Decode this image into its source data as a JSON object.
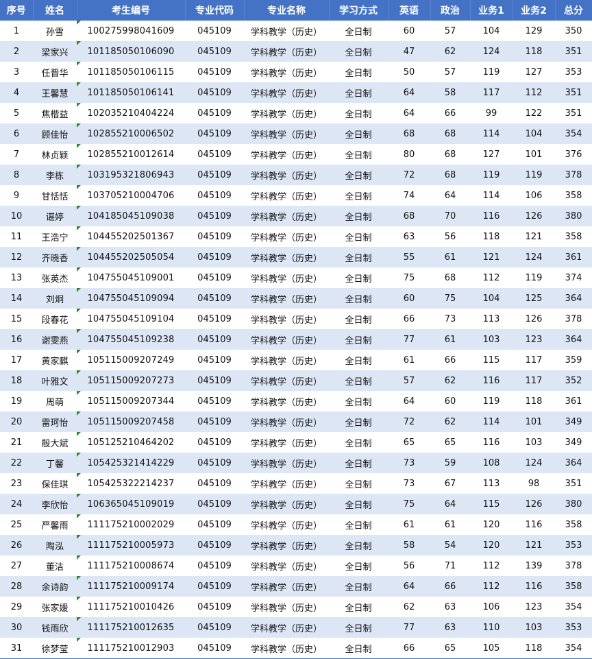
{
  "headers": [
    "序号",
    "姓名",
    "考生编号",
    "专业代码",
    "专业名称",
    "学习方式",
    "英语",
    "政治",
    "业务1",
    "业务2",
    "总分"
  ],
  "rows": [
    [
      "1",
      "孙雪",
      "100275998041609",
      "045109",
      "学科教学（历史）",
      "全日制",
      "60",
      "57",
      "104",
      "129",
      "350"
    ],
    [
      "2",
      "梁家兴",
      "101185050106090",
      "045109",
      "学科教学（历史）",
      "全日制",
      "47",
      "62",
      "124",
      "118",
      "351"
    ],
    [
      "3",
      "任晋华",
      "101185050106115",
      "045109",
      "学科教学（历史）",
      "全日制",
      "50",
      "57",
      "119",
      "127",
      "353"
    ],
    [
      "4",
      "王馨慧",
      "101185050106141",
      "045109",
      "学科教学（历史）",
      "全日制",
      "64",
      "58",
      "117",
      "112",
      "351"
    ],
    [
      "5",
      "焦楷益",
      "102035210404224",
      "045109",
      "学科教学（历史）",
      "全日制",
      "64",
      "66",
      "99",
      "122",
      "351"
    ],
    [
      "6",
      "顾佳怡",
      "102855210006502",
      "045109",
      "学科教学（历史）",
      "全日制",
      "68",
      "68",
      "114",
      "104",
      "354"
    ],
    [
      "7",
      "林贞颖",
      "102855210012614",
      "045109",
      "学科教学（历史）",
      "全日制",
      "80",
      "68",
      "127",
      "101",
      "376"
    ],
    [
      "8",
      "李栋",
      "103195321806943",
      "045109",
      "学科教学（历史）",
      "全日制",
      "72",
      "68",
      "119",
      "119",
      "378"
    ],
    [
      "9",
      "甘恬恬",
      "103705210004706",
      "045109",
      "学科教学（历史）",
      "全日制",
      "74",
      "64",
      "114",
      "106",
      "358"
    ],
    [
      "10",
      "谌婷",
      "104185045109038",
      "045109",
      "学科教学（历史）",
      "全日制",
      "68",
      "70",
      "116",
      "126",
      "380"
    ],
    [
      "11",
      "王浩宁",
      "104455202501367",
      "045109",
      "学科教学（历史）",
      "全日制",
      "63",
      "56",
      "118",
      "121",
      "358"
    ],
    [
      "12",
      "齐晓香",
      "104455202505054",
      "045109",
      "学科教学（历史）",
      "全日制",
      "55",
      "61",
      "121",
      "124",
      "361"
    ],
    [
      "13",
      "张英杰",
      "104755045109001",
      "045109",
      "学科教学（历史）",
      "全日制",
      "75",
      "68",
      "112",
      "119",
      "374"
    ],
    [
      "14",
      "刘炯",
      "104755045109094",
      "045109",
      "学科教学（历史）",
      "全日制",
      "60",
      "75",
      "104",
      "125",
      "364"
    ],
    [
      "15",
      "段春花",
      "104755045109104",
      "045109",
      "学科教学（历史）",
      "全日制",
      "66",
      "73",
      "113",
      "126",
      "378"
    ],
    [
      "16",
      "谢雯燕",
      "104755045109238",
      "045109",
      "学科教学（历史）",
      "全日制",
      "77",
      "61",
      "103",
      "123",
      "364"
    ],
    [
      "17",
      "黄家麒",
      "105115009207249",
      "045109",
      "学科教学（历史）",
      "全日制",
      "61",
      "66",
      "115",
      "117",
      "359"
    ],
    [
      "18",
      "叶雅文",
      "105115009207273",
      "045109",
      "学科教学（历史）",
      "全日制",
      "57",
      "62",
      "116",
      "117",
      "352"
    ],
    [
      "19",
      "周萌",
      "105115009207344",
      "045109",
      "学科教学（历史）",
      "全日制",
      "64",
      "60",
      "119",
      "118",
      "361"
    ],
    [
      "20",
      "雷珂怡",
      "105115009207458",
      "045109",
      "学科教学（历史）",
      "全日制",
      "72",
      "62",
      "114",
      "101",
      "349"
    ],
    [
      "21",
      "殷大斌",
      "105125210464202",
      "045109",
      "学科教学（历史）",
      "全日制",
      "65",
      "65",
      "116",
      "103",
      "349"
    ],
    [
      "22",
      "丁馨",
      "105425321414229",
      "045109",
      "学科教学（历史）",
      "全日制",
      "73",
      "59",
      "108",
      "124",
      "364"
    ],
    [
      "23",
      "保佳琪",
      "105425322214237",
      "045109",
      "学科教学（历史）",
      "全日制",
      "73",
      "67",
      "113",
      "98",
      "351"
    ],
    [
      "24",
      "李欣怡",
      "106365045109019",
      "045109",
      "学科教学（历史）",
      "全日制",
      "75",
      "64",
      "115",
      "126",
      "380"
    ],
    [
      "25",
      "严馨雨",
      "111175210002029",
      "045109",
      "学科教学（历史）",
      "全日制",
      "61",
      "61",
      "120",
      "116",
      "358"
    ],
    [
      "26",
      "陶泓",
      "111175210005973",
      "045109",
      "学科教学（历史）",
      "全日制",
      "58",
      "54",
      "120",
      "121",
      "353"
    ],
    [
      "27",
      "董洁",
      "111175210008674",
      "045109",
      "学科教学（历史）",
      "全日制",
      "56",
      "71",
      "112",
      "139",
      "378"
    ],
    [
      "28",
      "余诗韵",
      "111175210009174",
      "045109",
      "学科教学（历史）",
      "全日制",
      "64",
      "66",
      "112",
      "116",
      "358"
    ],
    [
      "29",
      "张家媛",
      "111175210010426",
      "045109",
      "学科教学（历史）",
      "全日制",
      "62",
      "63",
      "106",
      "123",
      "354"
    ],
    [
      "30",
      "钱雨欣",
      "111175210012635",
      "045109",
      "学科教学（历史）",
      "全日制",
      "77",
      "63",
      "110",
      "103",
      "353"
    ],
    [
      "31",
      "徐梦莹",
      "111175210012903",
      "045109",
      "学科教学（历史）",
      "全日制",
      "66",
      "65",
      "105",
      "118",
      "354"
    ]
  ],
  "colors": {
    "header_bg": "#4472c4",
    "header_text": "#ffffff",
    "band_bg": "#dce6f5",
    "marker": "#2a8c2a"
  }
}
